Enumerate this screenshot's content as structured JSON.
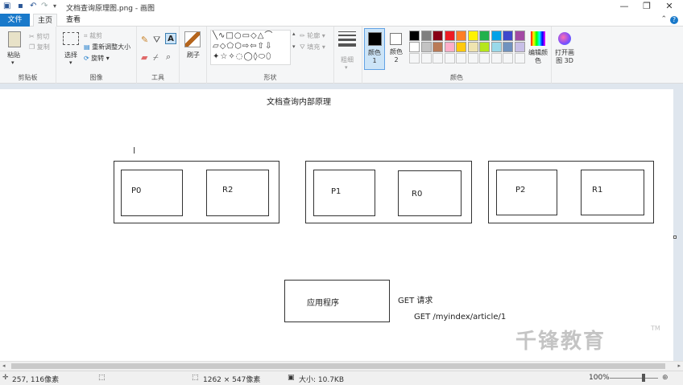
{
  "window": {
    "title": "文档查询原理图.png - 画图",
    "minimize": "—",
    "maximize": "❐",
    "close": "✕"
  },
  "tabs": {
    "file": "文件",
    "home": "主页",
    "view": "查看"
  },
  "clipboard": {
    "paste": "粘贴",
    "cut": "剪切",
    "copy": "复制",
    "label": "剪贴板"
  },
  "image": {
    "select": "选择",
    "crop": "裁剪",
    "resize": "重新调整大小",
    "rotate": "旋转",
    "label": "图像"
  },
  "tools": {
    "label": "工具"
  },
  "brushes": {
    "label": "刷子"
  },
  "shapes": {
    "outline": "轮廓",
    "fill": "填充",
    "label": "形状"
  },
  "size": {
    "label": "粗细"
  },
  "colors": {
    "color1": "颜色 1",
    "color2": "颜色 2",
    "edit": "编辑颜色",
    "label": "颜色",
    "palette_row1": [
      "#000000",
      "#7f7f7f",
      "#880015",
      "#ed1c24",
      "#ff7f27",
      "#fff200",
      "#22b14c",
      "#00a2e8",
      "#3f48cc",
      "#a349a4"
    ],
    "palette_row2": [
      "#ffffff",
      "#c3c3c3",
      "#b97a57",
      "#ffaec9",
      "#ffc90e",
      "#efe4b0",
      "#b5e61d",
      "#99d9ea",
      "#7092be",
      "#c8bfe7"
    ]
  },
  "paint3d": {
    "label": "打开画图 3D"
  },
  "canvas": {
    "title": "文档查询内部原理",
    "nodes": [
      {
        "shards": [
          "P0",
          "R2"
        ]
      },
      {
        "shards": [
          "P1",
          "R0"
        ]
      },
      {
        "shards": [
          "P2",
          "R1"
        ]
      }
    ],
    "app": "应用程序",
    "get_label": "GET  请求",
    "get_path": "GET /myindex/article/1"
  },
  "status": {
    "cursor": "257, 116像素",
    "dimensions": "1262 × 547像素",
    "filesize": "大小: 10.7KB",
    "zoom": "100%"
  },
  "watermark": {
    "text": "千锋教育",
    "tm": "TM"
  }
}
